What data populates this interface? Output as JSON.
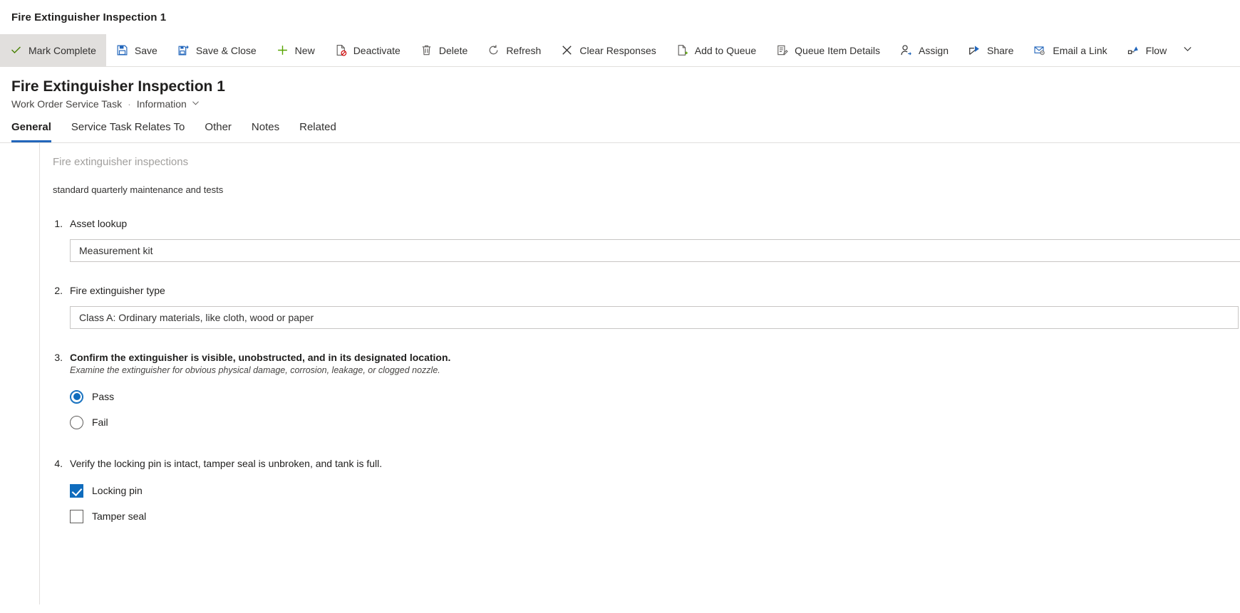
{
  "window": {
    "app_title": "Fire Extinguisher Inspection 1"
  },
  "commandbar": {
    "items": [
      {
        "label": "Mark Complete",
        "icon": "checkmark-icon",
        "active": true
      },
      {
        "label": "Save",
        "icon": "save-icon",
        "active": false
      },
      {
        "label": "Save & Close",
        "icon": "save-and-close-icon",
        "active": false
      },
      {
        "label": "New",
        "icon": "plus-icon",
        "active": false
      },
      {
        "label": "Deactivate",
        "icon": "deactivate-icon",
        "active": false
      },
      {
        "label": "Delete",
        "icon": "trash-icon",
        "active": false
      },
      {
        "label": "Refresh",
        "icon": "refresh-icon",
        "active": false
      },
      {
        "label": "Clear Responses",
        "icon": "close-x-icon",
        "active": false
      },
      {
        "label": "Add to Queue",
        "icon": "add-to-queue-icon",
        "active": false
      },
      {
        "label": "Queue Item Details",
        "icon": "queue-item-details-icon",
        "active": false
      },
      {
        "label": "Assign",
        "icon": "assign-person-icon",
        "active": false
      },
      {
        "label": "Share",
        "icon": "share-icon",
        "active": false
      },
      {
        "label": "Email a Link",
        "icon": "email-link-icon",
        "active": false
      },
      {
        "label": "Flow",
        "icon": "flow-icon",
        "active": false
      }
    ],
    "overflow_icon": "chevron-down-icon"
  },
  "record": {
    "title": "Fire Extinguisher Inspection 1",
    "entity": "Work Order Service Task",
    "separator": "·",
    "form_name": "Information",
    "form_chevron_icon": "chevron-down-icon"
  },
  "tabs": [
    {
      "label": "General",
      "selected": true
    },
    {
      "label": "Service Task Relates To",
      "selected": false
    },
    {
      "label": "Other",
      "selected": false
    },
    {
      "label": "Notes",
      "selected": false
    },
    {
      "label": "Related",
      "selected": false
    }
  ],
  "form": {
    "section_title": "Fire extinguisher inspections",
    "section_description": "standard quarterly maintenance and tests",
    "questions": [
      {
        "number": "1.",
        "text": "Asset lookup",
        "bold": false,
        "hint": "",
        "type": "lookup",
        "value": "Measurement kit"
      },
      {
        "number": "2.",
        "text": "Fire extinguisher type",
        "bold": false,
        "hint": "",
        "type": "text",
        "value": "Class A: Ordinary materials, like cloth, wood or paper"
      },
      {
        "number": "3.",
        "text": "Confirm the extinguisher is visible, unobstructed, and in its designated location.",
        "bold": true,
        "hint": "Examine the extinguisher for obvious physical damage, corrosion, leakage, or clogged nozzle.",
        "type": "radio",
        "options": [
          {
            "label": "Pass",
            "checked": true
          },
          {
            "label": "Fail",
            "checked": false
          }
        ]
      },
      {
        "number": "4.",
        "text": "Verify the locking pin is intact, tamper seal is unbroken, and tank is full.",
        "bold": false,
        "hint": "",
        "type": "checkbox",
        "options": [
          {
            "label": "Locking pin",
            "checked": true
          },
          {
            "label": "Tamper seal",
            "checked": false
          }
        ]
      }
    ]
  },
  "colors": {
    "accent": "#0f6cbd",
    "tab_underline": "#2266bb",
    "command_active_bg": "#e1dfdd",
    "checkmark_green": "#498205"
  }
}
